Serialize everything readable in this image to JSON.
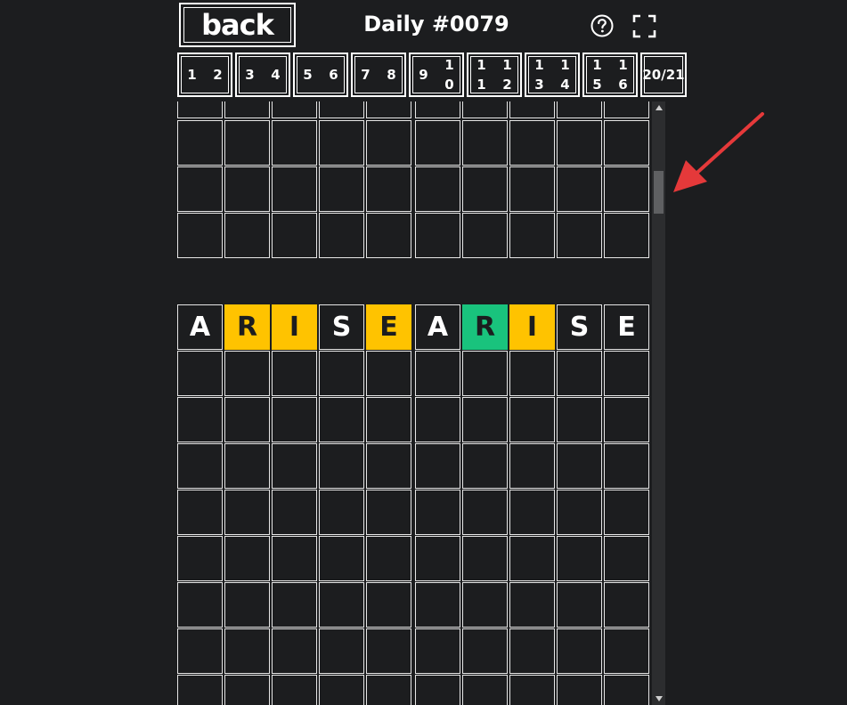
{
  "header": {
    "back_label": "back",
    "title": "Daily #0079",
    "help_icon": "question-circle-icon",
    "fullscreen_icon": "fullscreen-icon"
  },
  "board_nav": [
    {
      "digits": [
        "1",
        "2"
      ]
    },
    {
      "digits": [
        "3",
        "4"
      ]
    },
    {
      "digits": [
        "5",
        "6"
      ]
    },
    {
      "digits": [
        "7",
        "8"
      ]
    },
    {
      "digits": [
        "9",
        "1\n0"
      ]
    },
    {
      "digits": [
        "1\n1",
        "1\n2"
      ]
    },
    {
      "digits": [
        "1\n3",
        "1\n4"
      ]
    },
    {
      "digits": [
        "1\n5",
        "1\n6"
      ]
    },
    {
      "digits": [
        "20/21"
      ]
    }
  ],
  "grid": {
    "guess_row": [
      {
        "letter": "A",
        "state": "empty"
      },
      {
        "letter": "R",
        "state": "yellow"
      },
      {
        "letter": "I",
        "state": "yellow"
      },
      {
        "letter": "S",
        "state": "empty"
      },
      {
        "letter": "E",
        "state": "yellow"
      },
      {
        "letter": "A",
        "state": "empty"
      },
      {
        "letter": "R",
        "state": "green"
      },
      {
        "letter": "I",
        "state": "yellow"
      },
      {
        "letter": "S",
        "state": "empty"
      },
      {
        "letter": "E",
        "state": "empty"
      }
    ]
  },
  "colors": {
    "background": "#1c1d1f",
    "yellow": "#ffc300",
    "green": "#19c37d",
    "annotation_arrow": "#e5393a"
  }
}
